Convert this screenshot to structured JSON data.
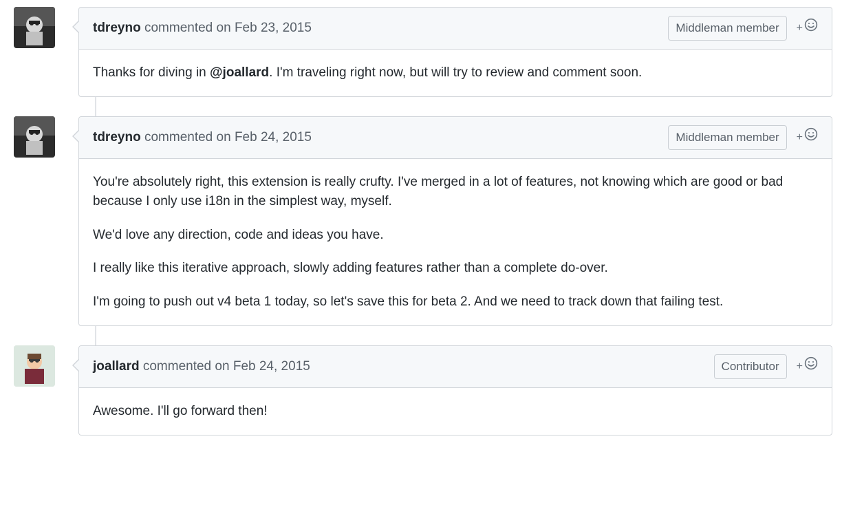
{
  "comments": [
    {
      "author": "tdreyno",
      "verb": "commented",
      "date_prefix": "on",
      "date": "Feb 23, 2015",
      "badge": "Middleman member",
      "avatar_type": "bw",
      "body": [
        {
          "type": "with_mention",
          "pre": "Thanks for diving in ",
          "mention": "@joallard",
          "post": ". I'm traveling right now, but will try to review and comment soon."
        }
      ]
    },
    {
      "author": "tdreyno",
      "verb": "commented",
      "date_prefix": "on",
      "date": "Feb 24, 2015",
      "badge": "Middleman member",
      "avatar_type": "bw",
      "body": [
        {
          "type": "plain",
          "text": "You're absolutely right, this extension is really crufty. I've merged in a lot of features, not knowing which are good or bad because I only use i18n in the simplest way, myself."
        },
        {
          "type": "plain",
          "text": "We'd love any direction, code and ideas you have."
        },
        {
          "type": "plain",
          "text": "I really like this iterative approach, slowly adding features rather than a complete do-over."
        },
        {
          "type": "plain",
          "text": "I'm going to push out v4 beta 1 today, so let's save this for beta 2. And we need to track down that failing test."
        }
      ]
    },
    {
      "author": "joallard",
      "verb": "commented",
      "date_prefix": "on",
      "date": "Feb 24, 2015",
      "badge": "Contributor",
      "avatar_type": "color",
      "body": [
        {
          "type": "plain",
          "text": "Awesome. I'll go forward then!"
        }
      ]
    }
  ]
}
